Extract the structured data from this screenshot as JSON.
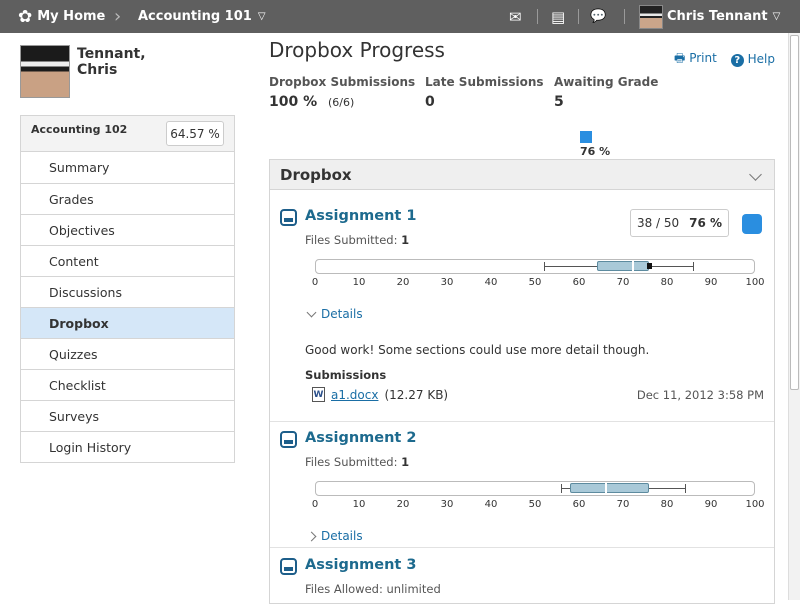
{
  "topbar": {
    "home_label": "My Home",
    "course_label": "Accounting 101",
    "user_name": "Chris Tennant"
  },
  "sidebar": {
    "user_name": "Tennant,\nChris",
    "course_name": "Accounting 102",
    "course_grade": "64.57 %",
    "items": [
      {
        "label": "Summary"
      },
      {
        "label": "Grades"
      },
      {
        "label": "Objectives"
      },
      {
        "label": "Content"
      },
      {
        "label": "Discussions"
      },
      {
        "label": "Dropbox",
        "active": true
      },
      {
        "label": "Quizzes"
      },
      {
        "label": "Checklist"
      },
      {
        "label": "Surveys"
      },
      {
        "label": "Login History"
      }
    ]
  },
  "main": {
    "title": "Dropbox Progress",
    "print_label": "Print",
    "help_label": "Help",
    "stats": [
      {
        "label": "Dropbox Submissions",
        "value": "100 %",
        "sub": "(6/6)"
      },
      {
        "label": "Late Submissions",
        "value": "0"
      },
      {
        "label": "Awaiting Grade",
        "value": "5"
      }
    ],
    "overall_progress": "76 %",
    "panel_title": "Dropbox",
    "axis_ticks": [
      "0",
      "10",
      "20",
      "30",
      "40",
      "50",
      "60",
      "70",
      "80",
      "90",
      "100"
    ],
    "assignments": [
      {
        "title": "Assignment 1",
        "files_label": "Files Submitted:",
        "files_value": "1",
        "score": "38 / 50",
        "percent": "76 %",
        "details_label": "Details",
        "feedback": "Good work! Some sections could use more detail though.",
        "submissions_label": "Submissions",
        "file_name": "a1.docx",
        "file_size": "(12.27 KB)",
        "file_date": "Dec 11, 2012 3:58 PM",
        "stats": {
          "min": 52,
          "q1": 64,
          "median": 72,
          "q3": 76,
          "max": 86,
          "mine": 76
        }
      },
      {
        "title": "Assignment 2",
        "files_label": "Files Submitted:",
        "files_value": "1",
        "details_label": "Details",
        "stats": {
          "min": 56,
          "q1": 58,
          "median": 66,
          "q3": 76,
          "max": 84
        }
      },
      {
        "title": "Assignment 3",
        "files_label": "Files Allowed:",
        "files_value": "unlimited"
      }
    ]
  },
  "colors": {
    "accent": "#2a8ee0",
    "link": "#1a6ea5",
    "topbar": "#5f5f5f",
    "active_item": "#d5e7f8"
  }
}
